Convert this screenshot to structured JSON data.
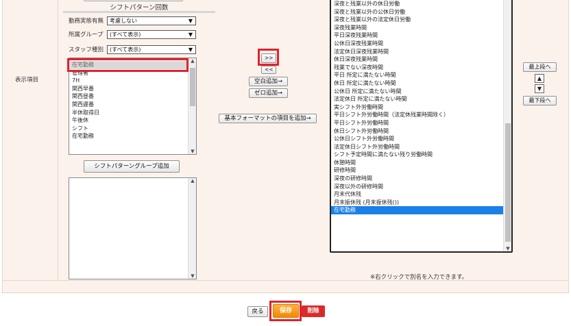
{
  "row_label": "表示項目",
  "section_title": "シフトパターン回数",
  "filters": [
    {
      "label": "勤務実態有無",
      "value": "考慮しない"
    },
    {
      "label": "所属グループ",
      "value": "(すべて表示)"
    },
    {
      "label": "スタッフ種別",
      "value": "(すべて表示)"
    }
  ],
  "left_list": [
    "在宅勤務",
    "管理者",
    "7H",
    "関西早番",
    "関西昼番",
    "関西遅番",
    "半休取得日",
    "午後休",
    "シフト",
    "在宅勤務"
  ],
  "group_add_button": "シフトパターングループ追加",
  "buttons": {
    "add": ">>",
    "remove": "<<",
    "blank_add": "空白追加→",
    "zero_add": "ゼロ追加→",
    "base_format_add": "基本フォーマットの項目を追加→",
    "move_top": "最上段へ",
    "move_up": "▲",
    "move_down": "▼",
    "move_bottom": "最下段へ",
    "back": "戻る",
    "save": "保存",
    "delete": "削除"
  },
  "right_list": [
    "深夜と残業以外の休日労働",
    "深夜と残業以外の公休日労働",
    "深夜と残業以外の法定休日労働",
    "深夜残業時間",
    "平日深夜残業時間",
    "公休日深夜残業時間",
    "法定休日深夜残業時間",
    "休日深夜残業時間",
    "残業でない深夜時間",
    "平日 所定に満たない時間",
    "休日 所定に満たない時間",
    "公休日 所定に満たない時間",
    "法定休日 所定に満たない時間",
    "実シフト外労働時間",
    "平日シフト外労働時間（法定休残業時間除く）",
    "平日シフト外労働時間",
    "休日シフト外労働時間",
    "公休日シフト外労働時間",
    "法定休日シフト外労働時間",
    "シフト予定時間に満たない残り労働時間",
    "休憩時間",
    "研修時間",
    "深夜の研修時間",
    "深夜以外の研修時間",
    "月末代休残",
    "月末振休残 (月末振休残())",
    "在宅勤務"
  ],
  "hint": "※右クリックで別名を入力できます。"
}
